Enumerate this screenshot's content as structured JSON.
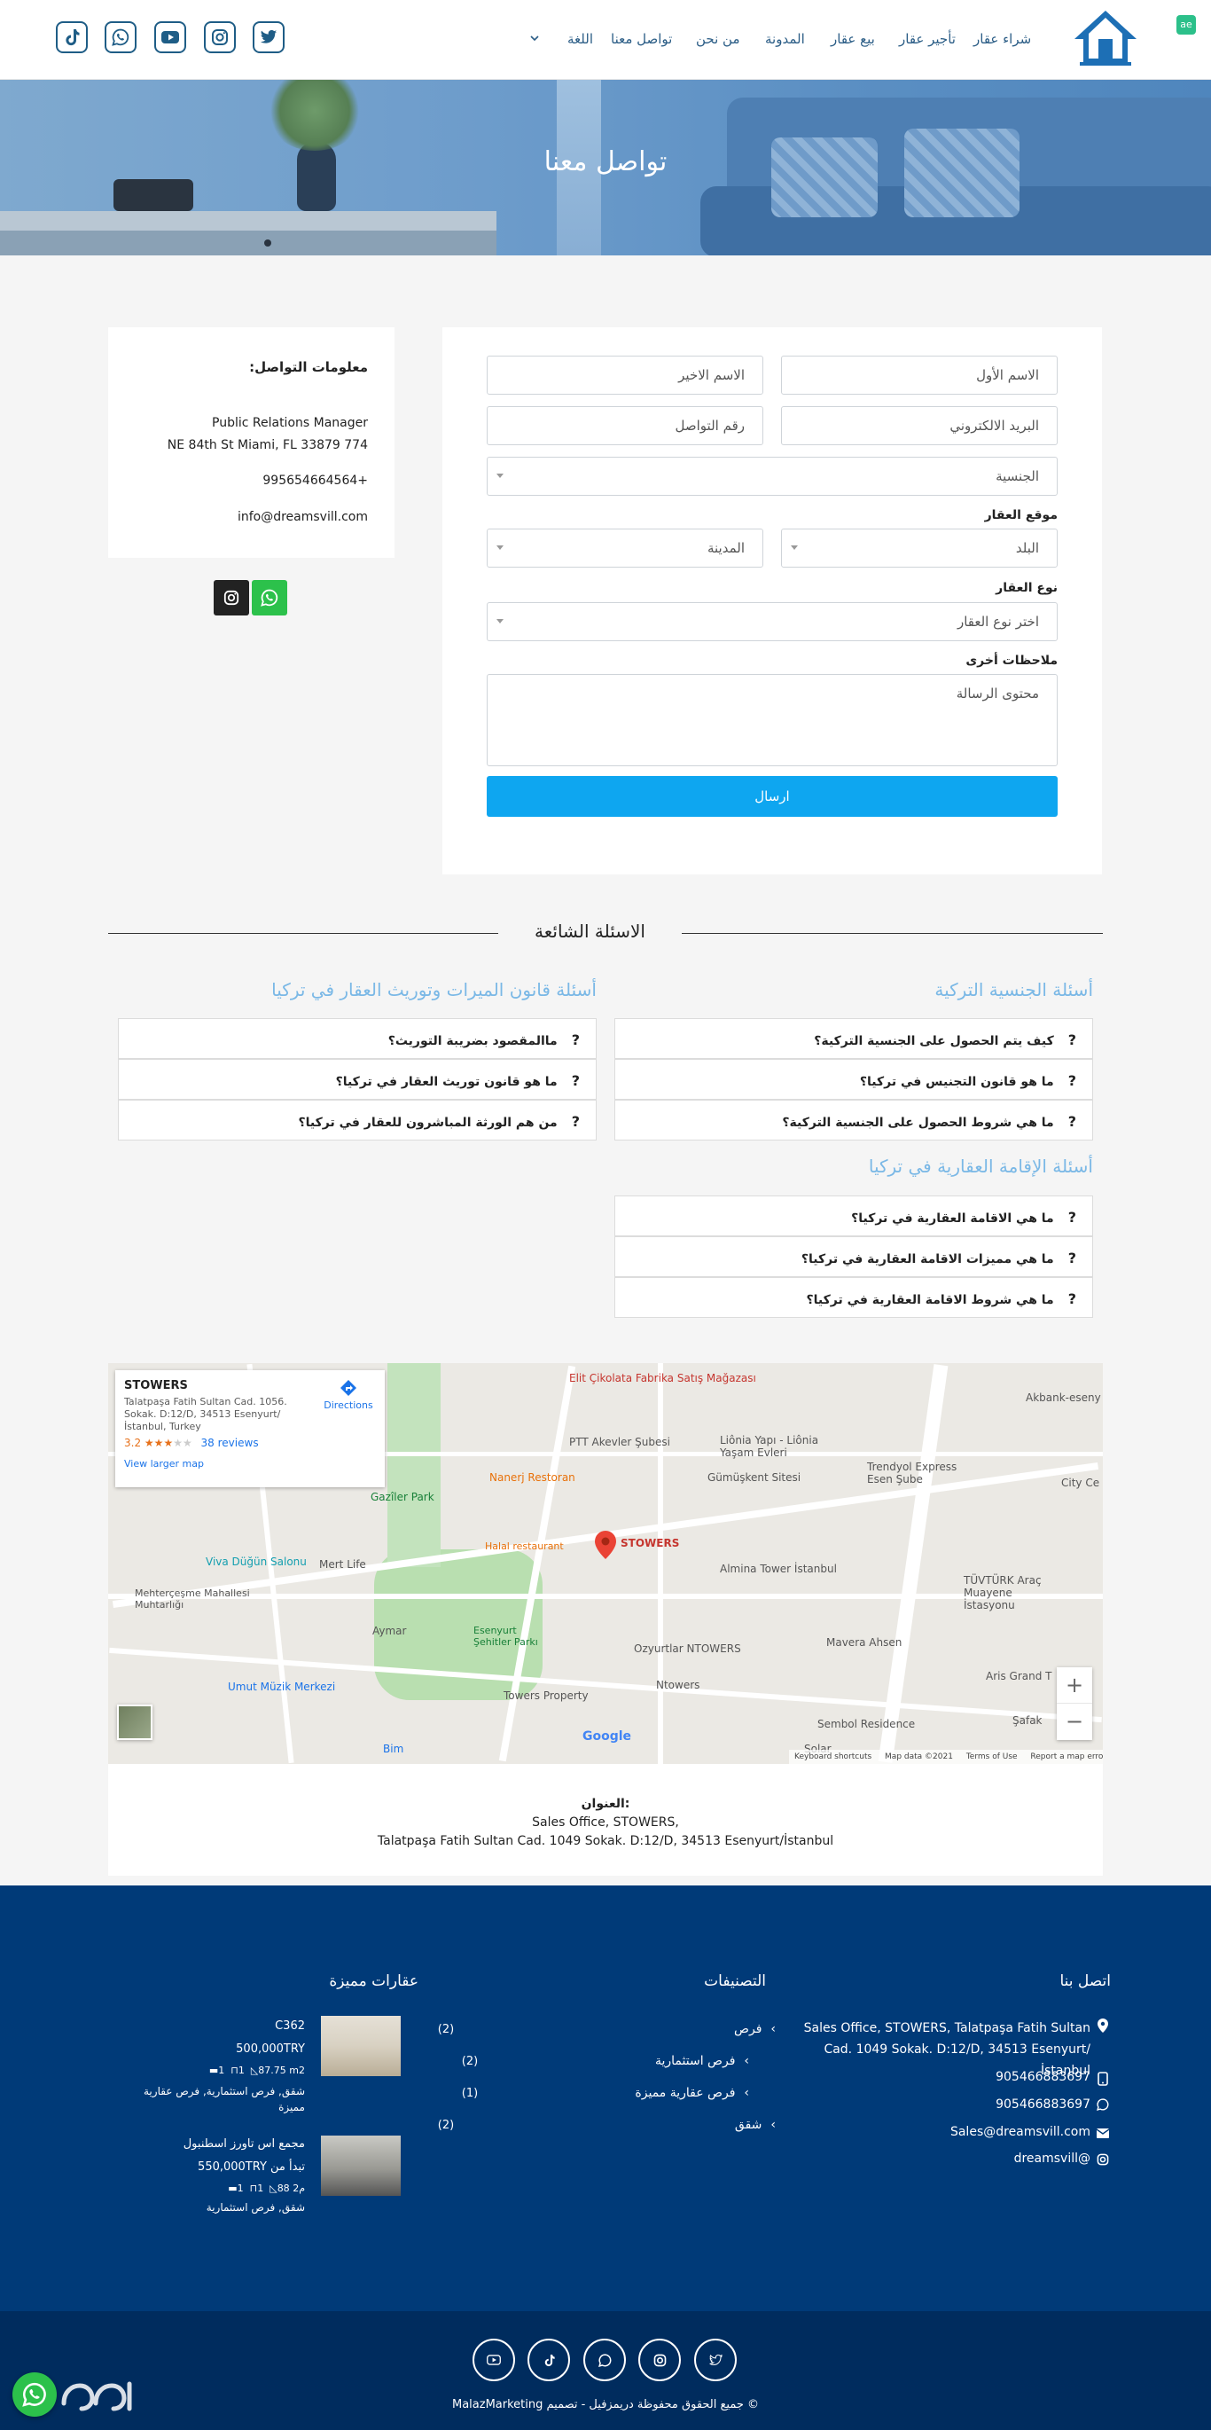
{
  "header": {
    "nav": [
      "شراء عقار",
      "تأجير عقار",
      "بيع عقار",
      "المدونة",
      "من نحن",
      "تواصل معنا",
      "اللغة"
    ],
    "lang_badge": "ae",
    "social_icons": [
      "twitter-icon",
      "instagram-icon",
      "youtube-icon",
      "whatsapp-icon",
      "tiktok-icon"
    ]
  },
  "hero": {
    "title": "تواصل معنا"
  },
  "form": {
    "first_name": "الاسم الأول",
    "last_name": "الاسم الاخير",
    "email": "البريد الالكتروني",
    "phone": "رقم التواصل",
    "nationality": "الجنسية",
    "location_label": "موقع العقار",
    "country": "البلد",
    "city": "المدينة",
    "type_label": "نوع العقار",
    "type_select": "اختر نوع العقار",
    "notes_label": "ملاحظات أخرى",
    "message": "محتوى الرسالة",
    "submit": "ارسال"
  },
  "contact_info": {
    "title": "معلومات التواصل:",
    "line1": "Public Relations Manager",
    "line2": "NE 84th St Miami, FL 33879 774",
    "phone": "995654664564+",
    "email": "info@dreamsvill.com"
  },
  "faq": {
    "title": "الاسئلة الشائعة",
    "groups": [
      {
        "title": "أسئلة الجنسية التركية",
        "items": [
          "كيف يتم الحصول على الجنسية التركية؟",
          "ما هو قانون التجنيس في تركيا؟",
          "ما هي شروط الحصول على الجنسية التركية؟"
        ]
      },
      {
        "title": "أسئلة قانون الميرات وتوريث العقار في تركيا",
        "items": [
          "ماالمقصود بضريبة التوريث؟",
          "ما هو قانون توريث العقار في تركيا؟",
          "من هم الورثة المباشرون للعقار في تركيا؟"
        ]
      },
      {
        "title": "أسئلة الإقامة العقارية في تركيا",
        "items": [
          "ما هي الاقامة العقارية في تركيا؟",
          "ما هي مميزات الاقامة العقارية في تركيا؟",
          "ما هي شروط الاقامة العقارية في تركيا؟"
        ]
      }
    ]
  },
  "map": {
    "card_title": "STOWERS",
    "card_address": "Talatpaşa Fatih Sultan Cad. 1056. Sokak. D:12/D, 34513 Esenyurt/ İstanbul, Turkey",
    "rating": "3.2",
    "reviews": "38 reviews",
    "directions": "Directions",
    "larger_map": "View larger map",
    "marker_label": "STOWERS",
    "pois": [
      "PTT Akevler Şubesi",
      "Nanerj Restoran",
      "Gazîler Park",
      "Halal restaurant",
      "Mert Life",
      "Viva Düğün Salonu",
      "Mehterçeşme Mahallesi Muhtarlığı",
      "Aymar",
      "Esenyurt Şehitler Parkı",
      "Umut Müzik Merkezi",
      "Towers Property",
      "Ozyurtlar NTOWERS",
      "Ntowers",
      "Bim",
      "Gümüşkent Sitesi",
      "Liônia Yapı - Liônia Yaşam Evleri",
      "Trendyol Express Esen Şube",
      "Almina Tower İstanbul",
      "Mavera Ahsen",
      "TÜVTÜRK Araç Muayene İstasyonu",
      "Aris Grand T",
      "Sembol Residence",
      "Şafak",
      "City Ce",
      "Akbank-eseny",
      "Elit Çikolata Fabrika Satış Mağazası",
      "Solar"
    ],
    "footer_links": [
      "Keyboard shortcuts",
      "Map data ©2021",
      "Terms of Use",
      "Report a map error"
    ],
    "google": "Google",
    "zoom_in": "+",
    "zoom_out": "−"
  },
  "address": {
    "label": "العنوان:",
    "line1": "Sales Office, STOWERS,",
    "line2": "Talatpaşa Fatih Sultan Cad. 1049 Sokak. D:12/D, 34513 Esenyurt/İstanbul"
  },
  "footer": {
    "contact_title": "اتصل بنا",
    "contact_address": "Sales Office, STOWERS, Talatpaşa Fatih Sultan Cad. 1049 Sokak. D:12/D, 34513 Esenyurt/İstanbul",
    "phone1": "905466883697",
    "phone2": "905466883697",
    "email": "Sales@dreamsvill.com",
    "instagram": "dreamsvill@",
    "categories_title": "التصنيفات",
    "categories": [
      {
        "name": "فرص",
        "count": "(2)"
      },
      {
        "name": "فرص استثمارية",
        "count": "(2)"
      },
      {
        "name": "فرص عقارية مميزة",
        "count": "(1)"
      },
      {
        "name": "شقق",
        "count": "(2)"
      }
    ],
    "featured_title": "عقارات مميزة",
    "properties": [
      {
        "name": "C362",
        "price": "500,000TRY",
        "price_prefix": "",
        "area": "87.75 m2",
        "rooms": "1",
        "baths": "1",
        "tags": "شقق, فرص استثمارية, فرص عقارية مميزة"
      },
      {
        "name": "مجمع اس تاورز اسطنبول",
        "price": "550,000TRY",
        "price_prefix": "تبدأ من",
        "area": "88 م2",
        "rooms": "1",
        "baths": "1",
        "tags": "شقق, فرص استثمارية"
      }
    ],
    "copyright": "© جميع الحقوق محفوظة دريمزفيل - تصميم MalazMarketing",
    "social_icons": [
      "youtube-icon",
      "tiktok-icon",
      "whatsapp-icon",
      "instagram-icon",
      "twitter-icon"
    ]
  },
  "colors": {
    "primary": "#0ea6f0",
    "navy": "#003a78",
    "navy_dark": "#002c5e",
    "faq_title": "#7ab8e6",
    "nav_text": "#2b5d86"
  }
}
